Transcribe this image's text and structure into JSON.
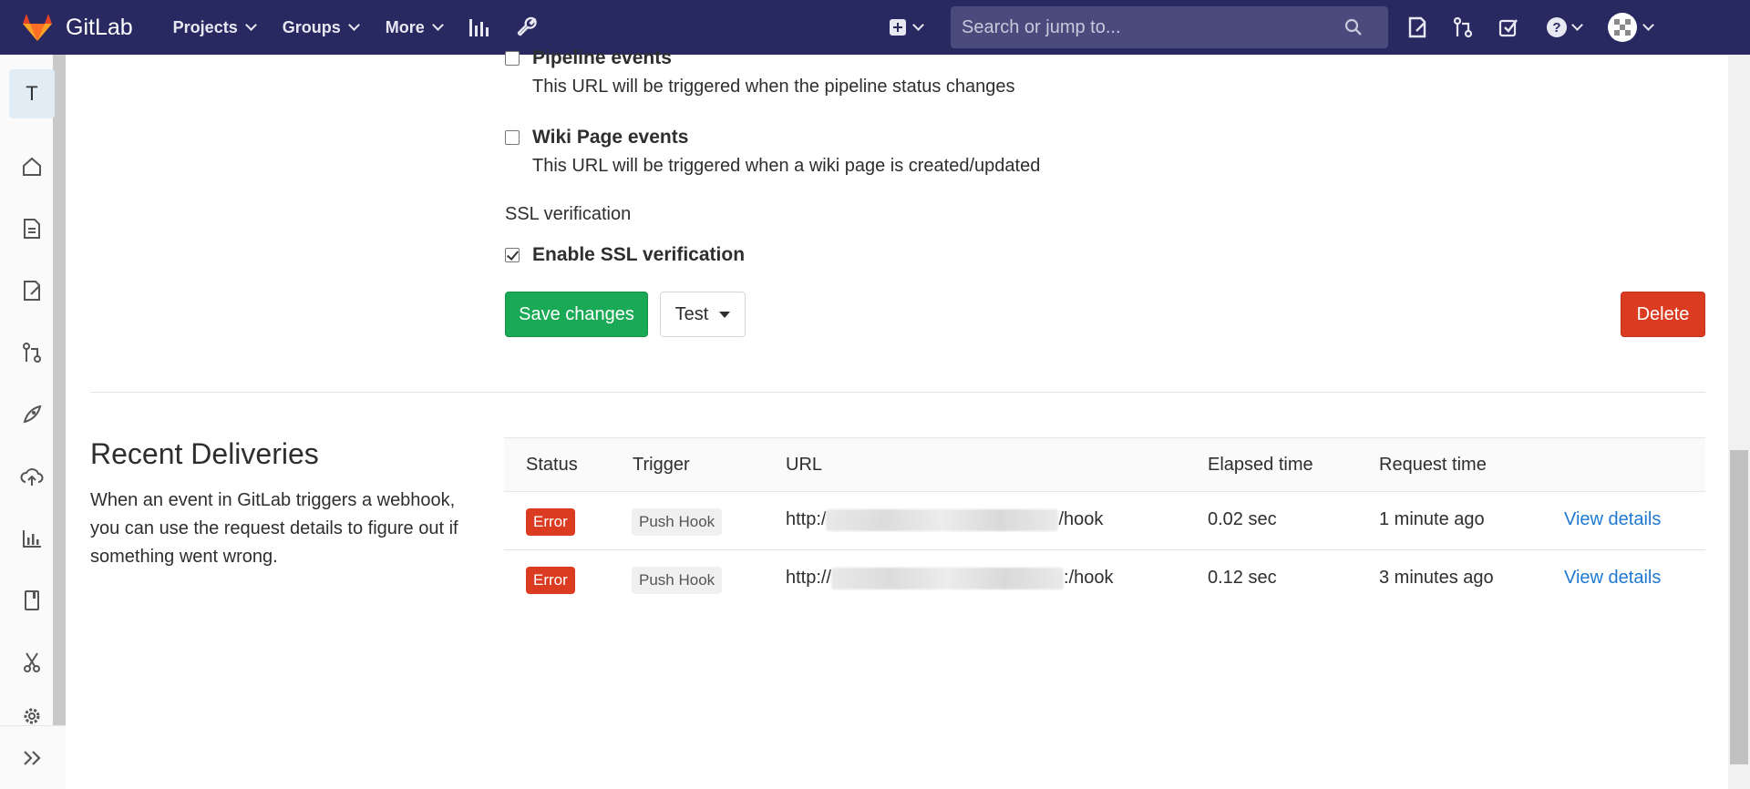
{
  "nav": {
    "brand": "GitLab",
    "menu": [
      "Projects",
      "Groups",
      "More"
    ],
    "search_placeholder": "Search or jump to..."
  },
  "sidebar": {
    "avatar_letter": "T",
    "icons": [
      "home-icon",
      "doc-icon",
      "issues-icon",
      "merge-request-icon",
      "rocket-icon",
      "cloud-icon",
      "chart-icon",
      "book-icon",
      "scissors-icon",
      "settings-icon"
    ]
  },
  "events": [
    {
      "title": "Pipeline events",
      "desc": "This URL will be triggered when the pipeline status changes",
      "checked": false
    },
    {
      "title": "Wiki Page events",
      "desc": "This URL will be triggered when a wiki page is created/updated",
      "checked": false
    }
  ],
  "ssl": {
    "label": "SSL verification",
    "option": "Enable SSL verification",
    "checked": true
  },
  "buttons": {
    "save": "Save changes",
    "test": "Test",
    "delete": "Delete"
  },
  "deliveries": {
    "title": "Recent Deliveries",
    "description": "When an event in GitLab triggers a webhook, you can use the request details to figure out if something went wrong.",
    "headers": [
      "Status",
      "Trigger",
      "URL",
      "Elapsed time",
      "Request time"
    ],
    "rows": [
      {
        "status": "Error",
        "trigger": "Push Hook",
        "url_prefix": "http:/",
        "url_suffix": "/hook",
        "elapsed": "0.02 sec",
        "time": "1 minute ago",
        "action": "View details"
      },
      {
        "status": "Error",
        "trigger": "Push Hook",
        "url_prefix": "http://",
        "url_suffix": ":/hook",
        "elapsed": "0.12 sec",
        "time": "3 minutes ago",
        "action": "View details"
      }
    ]
  },
  "colors": {
    "navbar": "#292961",
    "save": "#1aaa55",
    "delete": "#db3b21",
    "link": "#1f78d1"
  }
}
